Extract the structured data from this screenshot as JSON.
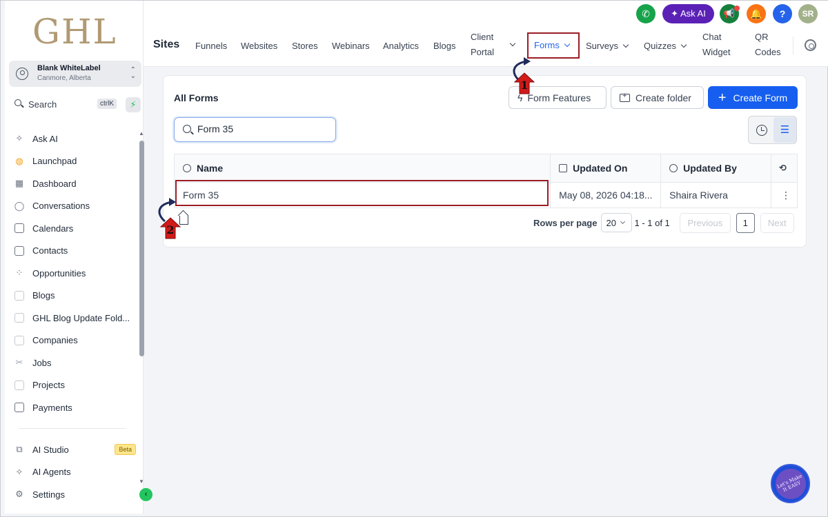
{
  "sidebar": {
    "logo": "GHL",
    "location": {
      "name": "Blank WhiteLabel",
      "city": "Canmore, Alberta"
    },
    "search": {
      "label": "Search",
      "shortcut": "ctrlK"
    },
    "items": [
      {
        "label": "Ask AI",
        "icon": "sparkle-icon"
      },
      {
        "label": "Launchpad",
        "icon": "rocket-icon"
      },
      {
        "label": "Dashboard",
        "icon": "grid-icon"
      },
      {
        "label": "Conversations",
        "icon": "chat-icon"
      },
      {
        "label": "Calendars",
        "icon": "calendar-icon"
      },
      {
        "label": "Contacts",
        "icon": "contacts-icon"
      },
      {
        "label": "Opportunities",
        "icon": "opportunities-icon"
      },
      {
        "label": "Blogs",
        "icon": "cube-icon"
      },
      {
        "label": "GHL Blog Update Fold...",
        "icon": "cube-icon"
      },
      {
        "label": "Companies",
        "icon": "cube-icon"
      },
      {
        "label": "Jobs",
        "icon": "scissors-icon"
      },
      {
        "label": "Projects",
        "icon": "cube-icon"
      },
      {
        "label": "Payments",
        "icon": "invoice-icon"
      }
    ],
    "bottom_items": [
      {
        "label": "AI Studio",
        "icon": "ai-studio-icon",
        "badge": "Beta"
      },
      {
        "label": "AI Agents",
        "icon": "sparkle-icon"
      },
      {
        "label": "Settings",
        "icon": "gear-icon"
      }
    ]
  },
  "header": {
    "title": "Sites",
    "tabs": {
      "funnels": "Funnels",
      "websites": "Websites",
      "stores": "Stores",
      "webinars": "Webinars",
      "analytics": "Analytics",
      "blogs": "Blogs",
      "client_portal_1": "Client",
      "client_portal_2": "Portal",
      "forms": "Forms",
      "surveys": "Surveys",
      "quizzes": "Quizzes",
      "chat_widget_1": "Chat",
      "chat_widget_2": "Widget",
      "qr_codes_1": "QR",
      "qr_codes_2": "Codes"
    },
    "ask_ai": "Ask AI",
    "avatar_initials": "SR",
    "help": "?"
  },
  "forms_page": {
    "title": "All Forms",
    "buttons": {
      "form_features": "Form Features",
      "create_folder": "Create folder",
      "create_form": "Create Form"
    },
    "search_value": "Form 35",
    "columns": [
      "Name",
      "Updated On",
      "Updated By"
    ],
    "rows": [
      {
        "name": "Form 35",
        "updated_on": "May 08, 2026 04:18...",
        "updated_by": "Shaira Rivera"
      }
    ],
    "pagination": {
      "rows_per_page_label": "Rows per page",
      "rows_per_page": "20",
      "range": "1 - 1 of 1",
      "previous": "Previous",
      "page": "1",
      "next": "Next"
    }
  },
  "annotations": {
    "step1": "1",
    "step2": "2"
  },
  "chat_widget": {
    "text": "Let's Make It EASY"
  },
  "colors": {
    "accent": "#155eef",
    "highlight": "#9b1c24",
    "brand_logo": "#b09a74"
  }
}
